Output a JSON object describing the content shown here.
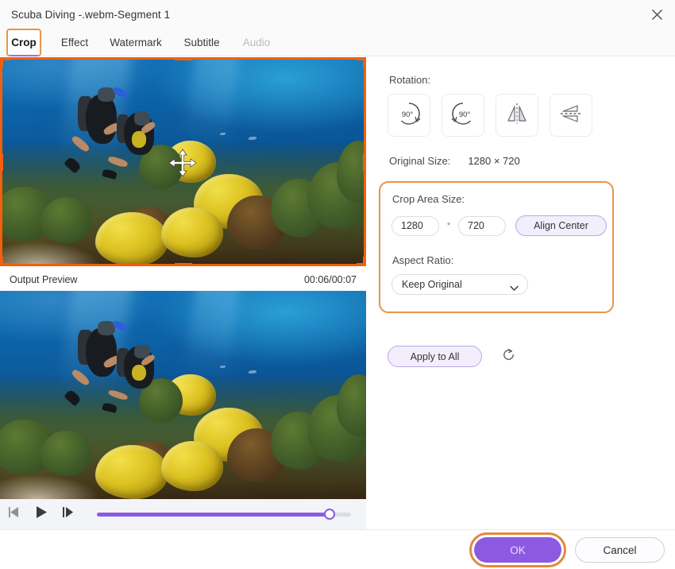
{
  "window": {
    "title": "Scuba Diving -.webm-Segment 1",
    "close_icon": "close-icon"
  },
  "tabs": [
    {
      "label": "Crop",
      "active": true,
      "disabled": false
    },
    {
      "label": "Effect",
      "active": false,
      "disabled": false
    },
    {
      "label": "Watermark",
      "active": false,
      "disabled": false
    },
    {
      "label": "Subtitle",
      "active": false,
      "disabled": false
    },
    {
      "label": "Audio",
      "active": false,
      "disabled": true
    }
  ],
  "preview": {
    "output_label": "Output Preview",
    "timestamp": "00:06/00:07",
    "move_cursor_icon": "move-icon",
    "crop_border_color": "#f2600c"
  },
  "player": {
    "prev_frame_icon": "previous-frame-icon",
    "play_icon": "play-icon",
    "next_frame_icon": "next-frame-icon",
    "progress_percent": 85,
    "accent_color": "#8c5ae0"
  },
  "panel": {
    "rotation_label": "Rotation:",
    "rotation_buttons": [
      {
        "name": "rotate-clockwise-90-icon",
        "label": "90°"
      },
      {
        "name": "rotate-counterclockwise-90-icon",
        "label": "90°"
      },
      {
        "name": "flip-horizontal-icon",
        "label": ""
      },
      {
        "name": "flip-vertical-icon",
        "label": ""
      }
    ],
    "original_size_label": "Original Size:",
    "original_size_value": "1280 × 720",
    "crop_area_label": "Crop Area Size:",
    "crop_width": "1280",
    "crop_height": "720",
    "multiply_symbol": "*",
    "align_center_label": "Align Center",
    "aspect_ratio_label": "Aspect Ratio:",
    "aspect_ratio_value": "Keep Original",
    "aspect_ratio_options": [
      "Keep Original"
    ],
    "apply_to_all_label": "Apply to All",
    "reset_icon": "reset-icon",
    "highlight_color": "#e8944a"
  },
  "footer": {
    "ok_label": "OK",
    "cancel_label": "Cancel"
  }
}
